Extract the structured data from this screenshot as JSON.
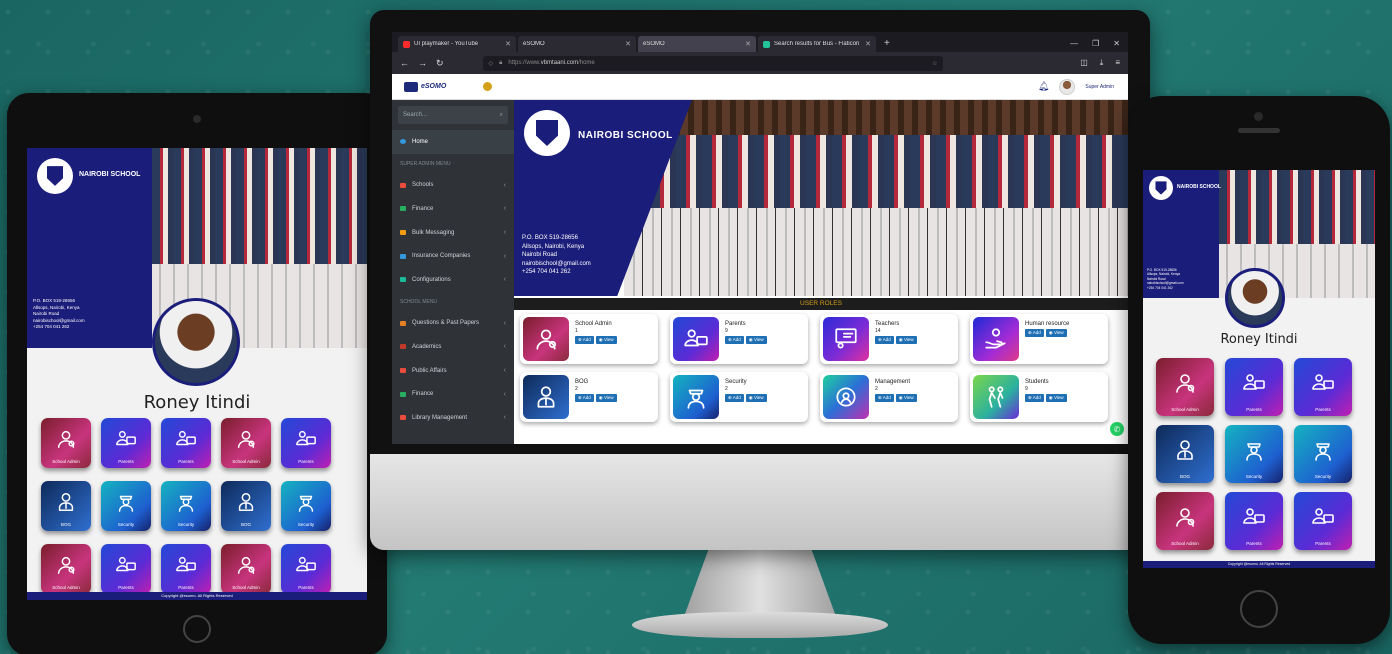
{
  "browser": {
    "tabs": [
      {
        "label": "UI playmaker - YouTube",
        "color": "#ff2b2b"
      },
      {
        "label": "eSOMO",
        "color": "#1d2a7a"
      },
      {
        "label": "eSOMO",
        "color": "#1d2a7a"
      },
      {
        "label": "Search results for Bus - Flaticon",
        "color": "#22c39a"
      }
    ],
    "new_tab": "+",
    "url_scheme": "https://www.",
    "url_domain": "vbmtaani.com",
    "url_path": "/home"
  },
  "app": {
    "logo_text": "eSOMO",
    "user_name": "Super Admin",
    "search_placeholder": "Search...",
    "sidebar": {
      "home": "Home",
      "section1": "SUPER ADMIN MENU",
      "section1_items": [
        {
          "label": "Schools",
          "color": "#e74c3c"
        },
        {
          "label": "Finance",
          "color": "#27ae60"
        },
        {
          "label": "Bulk Messaging",
          "color": "#f39c12"
        },
        {
          "label": "Insurance Companies",
          "color": "#3498db"
        },
        {
          "label": "Configurations",
          "color": "#1abc9c"
        }
      ],
      "section2": "SCHOOL MENU",
      "section2_items": [
        {
          "label": "Questions & Past Papers",
          "color": "#e67e22"
        },
        {
          "label": "Academics",
          "color": "#c0392b"
        },
        {
          "label": "Public Affairs",
          "color": "#e74c3c"
        },
        {
          "label": "Finance",
          "color": "#27ae60"
        },
        {
          "label": "Library Management",
          "color": "#e74c3c"
        }
      ]
    },
    "school": {
      "name": "NAIROBI SCHOOL",
      "address1": "P.O. BOX 519-28656",
      "address2": "Allsops, Nairobi, Kenya",
      "address3": "Nairobi Road",
      "email": "nairobischool@gmail.com",
      "phone": "+254 704 041 262"
    },
    "roles_title": "USER ROLES",
    "add_label": "Add",
    "view_label": "View",
    "roles": [
      {
        "name": "School Admin",
        "count": "1",
        "icon": "admin-icon",
        "gradient": "g-admin"
      },
      {
        "name": "Parents",
        "count": "9",
        "icon": "parent-icon",
        "gradient": "g-parent"
      },
      {
        "name": "Teachers",
        "count": "14",
        "icon": "teacher-icon",
        "gradient": "g-teacher"
      },
      {
        "name": "Human resource",
        "count": "",
        "icon": "hr-icon",
        "gradient": "g-hr"
      },
      {
        "name": "BOG",
        "count": "2",
        "icon": "bog-icon",
        "gradient": "g-bog"
      },
      {
        "name": "Security",
        "count": "2",
        "icon": "security-icon",
        "gradient": "g-security"
      },
      {
        "name": "Management",
        "count": "2",
        "icon": "management-icon",
        "gradient": "g-mgmt"
      },
      {
        "name": "Students",
        "count": "9",
        "icon": "students-icon",
        "gradient": "g-students"
      }
    ]
  },
  "mobile": {
    "student_name": "Roney Itindi",
    "footer": "Copyright @esomo. All Rights Reserved",
    "tablet_tiles": [
      {
        "label": "School Admin",
        "g": "g-admin",
        "icon": "admin"
      },
      {
        "label": "Parents",
        "g": "g-parent",
        "icon": "parent"
      },
      {
        "label": "Parents",
        "g": "g-parent",
        "icon": "parent"
      },
      {
        "label": "School Admin",
        "g": "g-admin",
        "icon": "admin"
      },
      {
        "label": "Parents",
        "g": "g-parent",
        "icon": "parent"
      },
      {
        "label": "BOG",
        "g": "g-bog",
        "icon": "bog"
      },
      {
        "label": "Security",
        "g": "g-security",
        "icon": "security"
      },
      {
        "label": "Security",
        "g": "g-security",
        "icon": "security"
      },
      {
        "label": "BOG",
        "g": "g-bog",
        "icon": "bog"
      },
      {
        "label": "Security",
        "g": "g-security",
        "icon": "security"
      },
      {
        "label": "School Admin",
        "g": "g-admin",
        "icon": "admin"
      },
      {
        "label": "Parents",
        "g": "g-parent",
        "icon": "parent"
      },
      {
        "label": "Parents",
        "g": "g-parent",
        "icon": "parent"
      },
      {
        "label": "School Admin",
        "g": "g-admin",
        "icon": "admin"
      },
      {
        "label": "Parents",
        "g": "g-parent",
        "icon": "parent"
      }
    ],
    "phone_tiles": [
      {
        "label": "School Admin",
        "g": "g-admin",
        "icon": "admin"
      },
      {
        "label": "Parents",
        "g": "g-parent",
        "icon": "parent"
      },
      {
        "label": "Parents",
        "g": "g-parent",
        "icon": "parent"
      },
      {
        "label": "BOG",
        "g": "g-bog",
        "icon": "bog"
      },
      {
        "label": "Security",
        "g": "g-security",
        "icon": "security"
      },
      {
        "label": "Security",
        "g": "g-security",
        "icon": "security"
      },
      {
        "label": "School Admin",
        "g": "g-admin",
        "icon": "admin"
      },
      {
        "label": "Parents",
        "g": "g-parent",
        "icon": "parent"
      },
      {
        "label": "Parents",
        "g": "g-parent",
        "icon": "parent"
      }
    ]
  }
}
